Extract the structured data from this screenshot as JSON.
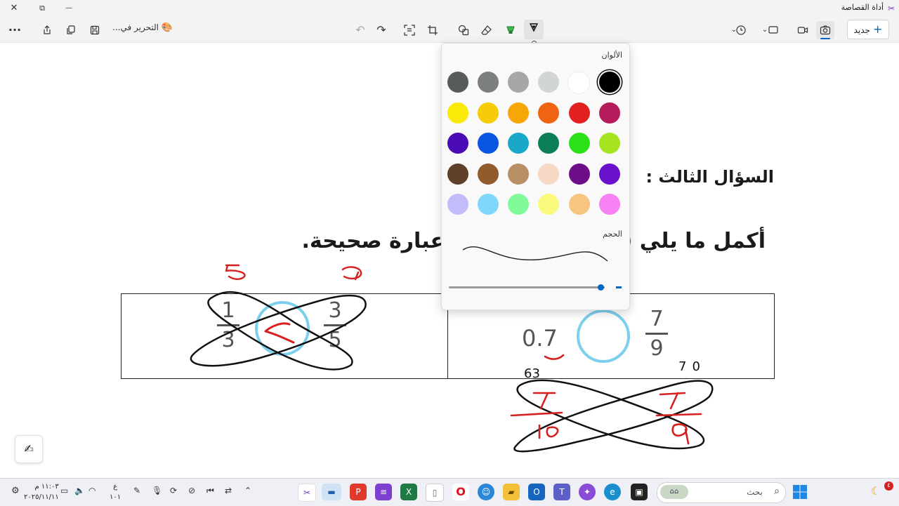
{
  "window": {
    "title": "أداة القصاصة",
    "close_glyph": "✕",
    "restore_glyph": "⧉",
    "minimize_glyph": "—"
  },
  "toolbar": {
    "new_label": "جديد",
    "editing_label": "التحرير في...",
    "more_glyph": "···"
  },
  "document": {
    "question_title": "السؤال الثالث :",
    "instruction": "أكمل ما يلي ( ) > أو = لتكوين عبارة صحيحة.",
    "left_cell": {
      "frac_a_num": "1",
      "frac_a_den": "3",
      "frac_b_num": "3",
      "frac_b_den": "5"
    },
    "right_cell": {
      "decimal": "0.7",
      "frac_num": "7",
      "frac_den": "9"
    }
  },
  "popup": {
    "colors_label": "الألوان",
    "size_label": "الحجم",
    "swatches": [
      [
        "#000000",
        "#ffffff",
        "#d1d5d6",
        "#a6a8a8",
        "#7c7f80",
        "#575b5c"
      ],
      [
        "#b51a5a",
        "#e22020",
        "#ef6410",
        "#f7a705",
        "#f7cb08",
        "#fbe90a"
      ],
      [
        "#a6e41f",
        "#2de11a",
        "#0b7e55",
        "#1aa8c8",
        "#0a56e2",
        "#4a0bb4"
      ],
      [
        "#6a11cc",
        "#6d0d88",
        "#f6d8c4",
        "#b99065",
        "#925b2e",
        "#5e3f2a"
      ],
      [
        "#f780f2",
        "#f7c57f",
        "#fafa7e",
        "#81fa9a",
        "#7fd7fb",
        "#c3bcfb"
      ]
    ],
    "selected_color": "#000000",
    "size_value": 0.95
  },
  "taskbar": {
    "search_placeholder": "بحث",
    "time": "١١:٠٣ م",
    "date": "٢٠٢٥/١١/١١",
    "lang_top": "ع",
    "lang_bottom": "١٠١",
    "notification_count": "٤"
  },
  "ink_digits": {
    "top_left": "5",
    "top_mid": "9",
    "under_decimal": "63",
    "under_frac": "70"
  }
}
